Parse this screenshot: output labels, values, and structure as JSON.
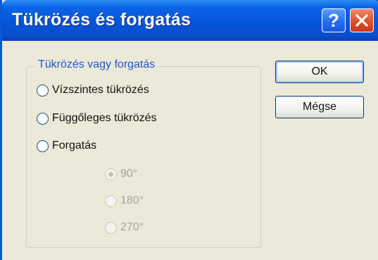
{
  "window": {
    "title": "Tükrözés és forgatás"
  },
  "titlebar_buttons": {
    "help_label": "?",
    "close_icon": "close-icon"
  },
  "group": {
    "legend": "Tükrözés vagy forgatás",
    "options": [
      {
        "label": "Vízszintes tükrözés",
        "selected": false,
        "enabled": true
      },
      {
        "label": "Függőleges tükrözés",
        "selected": false,
        "enabled": true
      },
      {
        "label": "Forgatás",
        "selected": false,
        "enabled": true
      }
    ],
    "angles": [
      {
        "label": "90°",
        "selected": true,
        "enabled": false
      },
      {
        "label": "180°",
        "selected": false,
        "enabled": false
      },
      {
        "label": "270°",
        "selected": false,
        "enabled": false
      }
    ]
  },
  "buttons": {
    "ok_label": "OK",
    "cancel_label": "Mégse"
  },
  "colors": {
    "titlebar": "#0454d8",
    "legend": "#1d56d8",
    "face": "#ece9d8",
    "close": "#e2542d"
  }
}
